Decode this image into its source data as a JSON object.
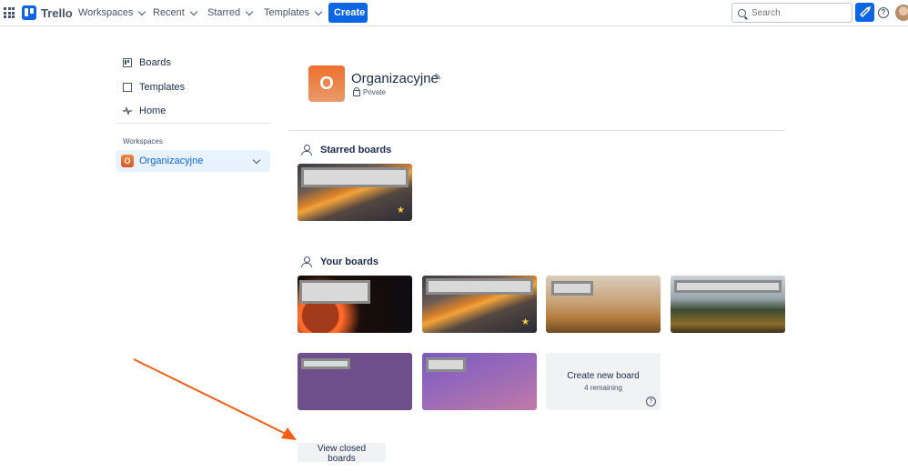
{
  "topbar": {
    "logo_text": "Trello",
    "nav": [
      "Workspaces",
      "Recent",
      "Starred",
      "Templates"
    ],
    "create_label": "Create",
    "search_placeholder": "Search",
    "accent": "#0c66e4"
  },
  "sidebar": {
    "items": [
      {
        "label": "Boards",
        "icon": "board-icon"
      },
      {
        "label": "Templates",
        "icon": "template-icon"
      },
      {
        "label": "Home",
        "icon": "pulse-icon"
      }
    ],
    "workspaces_label": "Workspaces",
    "workspace": {
      "initial": "O",
      "name": "Organizacyjne"
    }
  },
  "workspace_header": {
    "initial": "O",
    "title": "Organizacyjne",
    "visibility": "Private"
  },
  "starred_section": {
    "title": "Starred boards",
    "boards": [
      {
        "background": "mountain",
        "starred": true
      }
    ]
  },
  "your_boards_section": {
    "title": "Your boards",
    "boards": [
      {
        "background": "planet",
        "starred": false
      },
      {
        "background": "mountain",
        "starred": true
      },
      {
        "background": "field",
        "starred": false
      },
      {
        "background": "forest",
        "starred": false
      },
      {
        "background": "purple",
        "starred": false
      },
      {
        "background": "purple-gradient",
        "starred": false
      }
    ],
    "create_tile": {
      "title": "Create new board",
      "remaining": "4 remaining"
    }
  },
  "view_closed_label": "View closed boards",
  "annotation_arrow_color": "#f25f14"
}
